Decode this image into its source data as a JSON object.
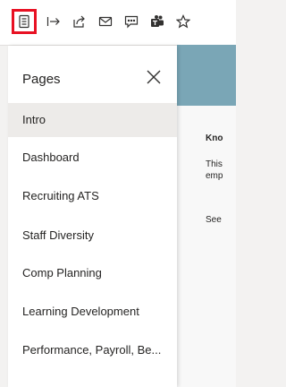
{
  "toolbar": {
    "icons": [
      "pages-pane-icon",
      "expand-arrow-icon",
      "share-icon",
      "email-icon",
      "comment-icon",
      "teams-icon",
      "favorite-star-icon"
    ],
    "selected_icon": "pages-pane-icon",
    "highlight_color": "#e81123"
  },
  "pages_panel": {
    "title": "Pages",
    "close_icon": "close-icon",
    "items": [
      {
        "label": "Intro",
        "active": true
      },
      {
        "label": "Dashboard",
        "active": false
      },
      {
        "label": "Recruiting ATS",
        "active": false
      },
      {
        "label": "Staff Diversity",
        "active": false
      },
      {
        "label": "Comp Planning",
        "active": false
      },
      {
        "label": "Learning Development",
        "active": false
      },
      {
        "label": "Performance, Payroll, Be...",
        "active": false
      }
    ]
  },
  "report": {
    "heading_fragment": "Kno",
    "line1_fragment": "This",
    "line2_fragment": "emp",
    "line3_fragment": "See",
    "band_color": "#7aa6b6"
  }
}
